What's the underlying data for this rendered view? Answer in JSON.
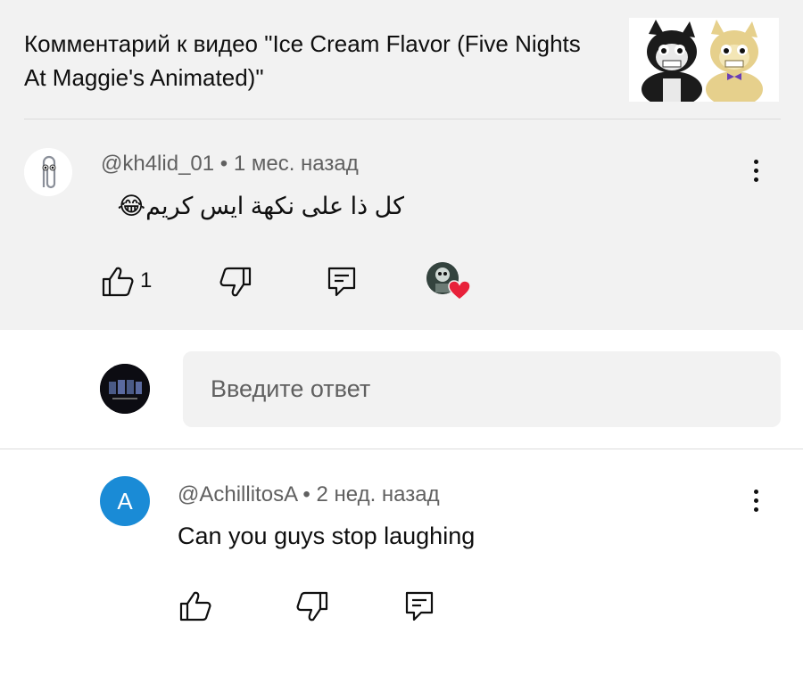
{
  "header": {
    "title": "Комментарий к видео \"Ice Cream Flavor (Five Nights At Maggie's Animated)\"",
    "thumbnail_icon": "video-thumbnail"
  },
  "comment": {
    "author": "@kh4lid_01",
    "time": "1 мес. назад",
    "meta_text": "@kh4lid_01 • 1 мес. назад",
    "text": "كل ذا على نكهة ايس كريم😂",
    "likes": "1",
    "actions": [
      "like-icon",
      "dislike-icon",
      "reply-icon",
      "creator-heart"
    ]
  },
  "reply_input": {
    "placeholder": "Введите ответ"
  },
  "reply": {
    "avatar_letter": "A",
    "avatar_color": "#1a8bd6",
    "author": "@AchillitosA",
    "time": "2 нед. назад",
    "meta_text": "@AchillitosA • 2 нед. назад",
    "text": "Can you guys stop laughing"
  },
  "colors": {
    "top_background": "#f2f2f2",
    "meta_text": "#606060",
    "heart": "#e8213a"
  }
}
